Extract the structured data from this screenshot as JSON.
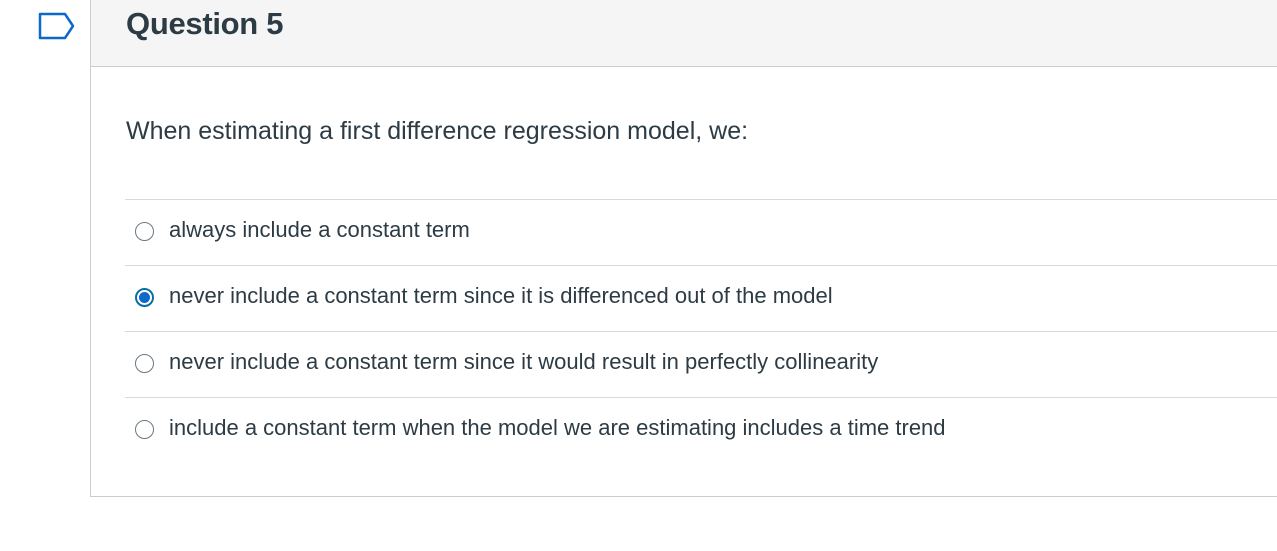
{
  "question": {
    "title": "Question 5",
    "text": "When estimating a first difference regression model, we:",
    "flag_icon": "flag-outline-icon"
  },
  "answers": [
    {
      "label": "always include a constant term",
      "selected": false
    },
    {
      "label": "never include a constant term since it is differenced out of the model",
      "selected": true
    },
    {
      "label": "never include a constant term since it would result in perfectly collinearity",
      "selected": false
    },
    {
      "label": "include a constant term when the model we are estimating includes a time trend",
      "selected": false
    }
  ],
  "colors": {
    "text": "#2d3b45",
    "header_bg": "#f5f5f5",
    "border": "#c7cdd1",
    "radio_selected": "#0e68c9"
  }
}
